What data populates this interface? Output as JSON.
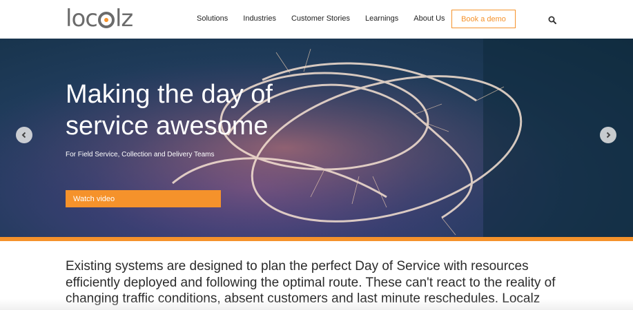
{
  "brand": {
    "logo_text_left": "loc",
    "logo_text_right": "lz",
    "accent": "#f5922b"
  },
  "nav": {
    "items": [
      "Solutions",
      "Industries",
      "Customer Stories",
      "Learnings",
      "About Us"
    ],
    "cta": "Book a demo",
    "search_icon": "search-icon"
  },
  "hero": {
    "title": "Making the day of service awesome",
    "subtitle": "For Field Service, Collection and Delivery Teams",
    "button": "Watch video",
    "prev_icon": "chevron-left-icon",
    "next_icon": "chevron-right-icon"
  },
  "intro": {
    "text": "Existing systems are designed to plan the perfect Day of Service with resources efficiently deployed and following the optimal route. These can't react to the reality of changing traffic conditions, absent customers and last minute reschedules. Localz"
  }
}
